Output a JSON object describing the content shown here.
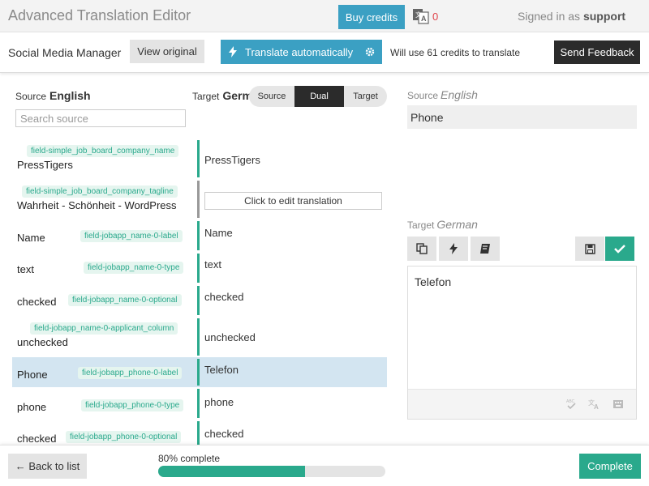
{
  "header": {
    "title": "Advanced Translation Editor",
    "buy_credits": "Buy credits",
    "credits_icon": "translate-credits-icon",
    "credits_count": "0",
    "signed_in_prefix": "Signed in as",
    "signed_in_user": "support"
  },
  "toolbar": {
    "project_name": "Social Media Manager",
    "view_original": "View original",
    "translate_auto": "Translate automatically",
    "will_use": "Will use 61 credits to translate",
    "send_feedback": "Send Feedback"
  },
  "left": {
    "source_label": "Source",
    "source_lang": "English",
    "target_label": "Target",
    "target_lang": "German",
    "view_modes": [
      "Source",
      "Dual",
      "Target"
    ],
    "active_view_mode": "Dual",
    "search_placeholder": "Search source",
    "rows": [
      {
        "tag": "field-simple_job_board_company_name",
        "source": "PressTigers",
        "target": "PressTigers"
      },
      {
        "tag": "field-simple_job_board_company_tagline",
        "source": "Wahrheit - Schönheit - WordPress",
        "target": "Click to edit translation"
      },
      {
        "tag": "field-jobapp_name-0-label",
        "source": "Name",
        "target": "Name"
      },
      {
        "tag": "field-jobapp_name-0-type",
        "source": "text",
        "target": "text"
      },
      {
        "tag": "field-jobapp_name-0-optional",
        "source": "checked",
        "target": "checked"
      },
      {
        "tag": "field-jobapp_name-0-applicant_column",
        "source": "unchecked",
        "target": "unchecked"
      },
      {
        "tag": "field-jobapp_phone-0-label",
        "source": "Phone",
        "target": "Telefon"
      },
      {
        "tag": "field-jobapp_phone-0-type",
        "source": "phone",
        "target": "phone"
      },
      {
        "tag": "field-jobapp_phone-0-optional",
        "source": "checked",
        "target": "checked"
      }
    ]
  },
  "right": {
    "source_label": "Source",
    "source_lang": "English",
    "source_text": "Phone",
    "target_label": "Target",
    "target_lang": "German",
    "target_text": "Telefon"
  },
  "footer": {
    "back": "← Back to list",
    "progress_text": "80% complete",
    "progress_value": 0.8,
    "complete": "Complete"
  },
  "colors": {
    "accent_blue": "#3ba0c3",
    "accent_green": "#2aa98c",
    "dark": "#2b2b2b",
    "selected_row": "#d3e5f1"
  }
}
